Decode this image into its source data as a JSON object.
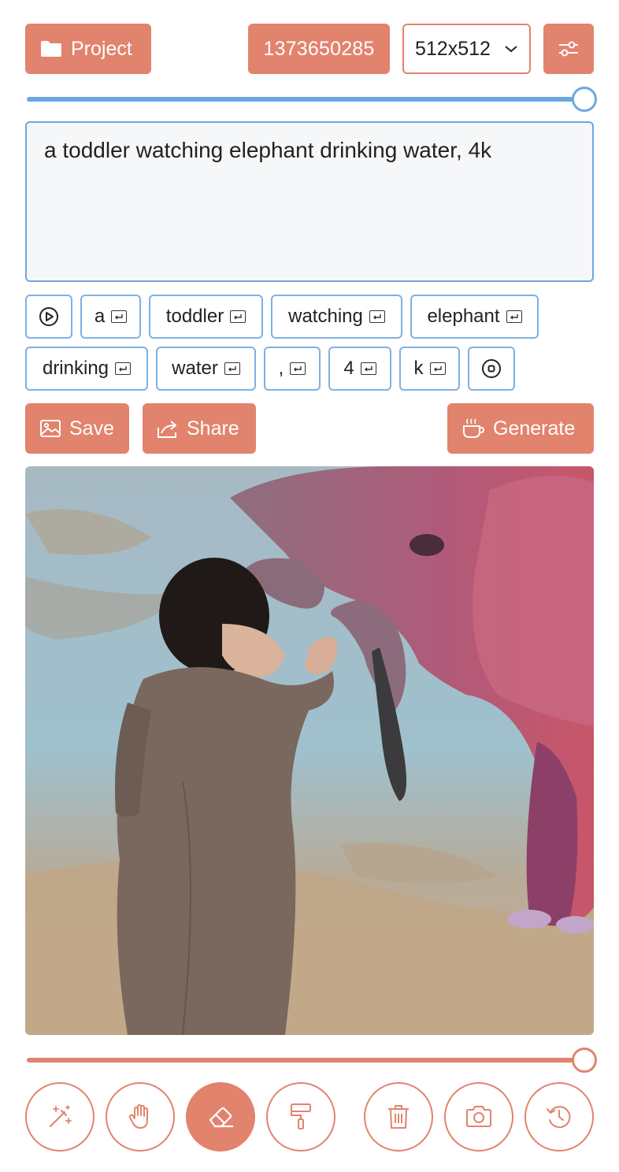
{
  "toolbar": {
    "project_label": "Project",
    "seed": "1373650285",
    "size": "512x512",
    "size_options": [
      "512x512"
    ]
  },
  "prompt_slider": {
    "value_fraction": 1.0,
    "color": "#6ea7e0"
  },
  "prompt": {
    "text": "a toddler watching elephant drinking water, 4k"
  },
  "tokens": [
    {
      "label": "a"
    },
    {
      "label": "toddler"
    },
    {
      "label": "watching"
    },
    {
      "label": "elephant"
    },
    {
      "label": "drinking"
    },
    {
      "label": "water"
    },
    {
      "label": ","
    },
    {
      "label": "4"
    },
    {
      "label": "k"
    }
  ],
  "actions": {
    "save_label": "Save",
    "share_label": "Share",
    "generate_label": "Generate"
  },
  "history_slider": {
    "value_fraction": 1.0,
    "color": "#e2836d"
  },
  "tools": [
    {
      "icon": "magic-wand-icon",
      "active": false
    },
    {
      "icon": "hand-icon",
      "active": false
    },
    {
      "icon": "eraser-icon",
      "active": true
    },
    {
      "icon": "paint-roller-icon",
      "active": false
    },
    {
      "icon": "trash-icon",
      "active": false
    },
    {
      "icon": "camera-icon",
      "active": false
    },
    {
      "icon": "history-icon",
      "active": false
    }
  ],
  "colors": {
    "accent": "#e2836d",
    "blue": "#6ea7e0"
  }
}
